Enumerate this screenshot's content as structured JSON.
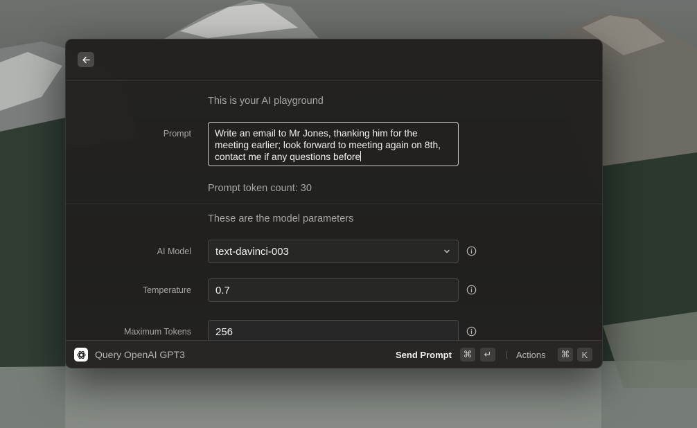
{
  "window": {
    "header": {
      "back_icon": "arrow-left-icon"
    },
    "prompt_section": {
      "title": "This is your AI playground",
      "prompt_label": "Prompt",
      "prompt_value": "Write an email to Mr Jones, thanking him for the meeting earlier; look forward to meeting again on 8th, contact me if any questions before",
      "token_count": "Prompt token count: 30"
    },
    "params_section": {
      "title": "These are the model parameters",
      "model_label": "AI Model",
      "model_value": "text-davinci-003",
      "temperature_label": "Temperature",
      "temperature_value": "0.7",
      "max_tokens_label": "Maximum Tokens",
      "max_tokens_value": "256"
    }
  },
  "bottombar": {
    "app_icon": "openai-logo-icon",
    "app_title": "Query OpenAI GPT3",
    "primary_action": "Send Prompt",
    "primary_shortcut": [
      "⌘",
      "↵"
    ],
    "actions_label": "Actions",
    "actions_shortcut": [
      "⌘",
      "K"
    ]
  },
  "colors": {
    "window_bg": "#201f1e",
    "text_primary": "#f2f0ed",
    "text_secondary": "#a9a6a2",
    "kbd_bg": "#3f3e3c"
  }
}
